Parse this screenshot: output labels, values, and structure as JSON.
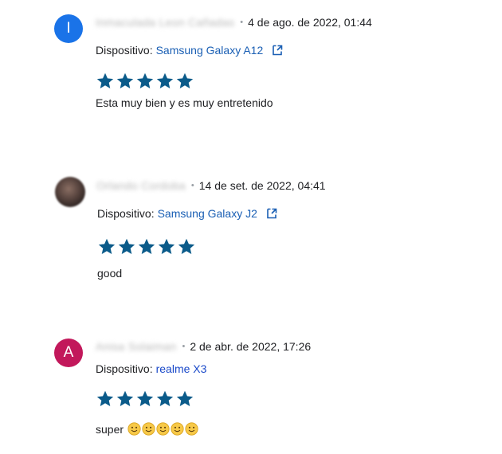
{
  "reviews": [
    {
      "avatar_letter": "I",
      "avatar_color": "#1a73e8",
      "author": "Inmaculada Leon Cañadas",
      "date": "4 de ago. de 2022, 01:44",
      "device_label": "Dispositivo:",
      "device_name": "Samsung Galaxy A12",
      "rating": 5,
      "text": "Esta muy bien y es muy entretenido"
    },
    {
      "avatar_letter": "",
      "avatar_color": "#3b2c2a",
      "author": "Orlando Cordoba",
      "date": "14 de set. de 2022, 04:41",
      "device_label": "Dispositivo:",
      "device_name": "Samsung Galaxy J2",
      "rating": 5,
      "text": "good"
    },
    {
      "avatar_letter": "A",
      "avatar_color": "#c2185b",
      "author": "Anisa Solaiman",
      "date": "2 de abr. de 2022, 17:26",
      "device_label": "Dispositivo:",
      "device_name": "realme X3",
      "rating": 5,
      "text": "super",
      "emoji": [
        "slightly-smiling-face",
        "slightly-smiling-face",
        "slightly-smiling-face",
        "slightly-smiling-face",
        "slightly-smiling-face"
      ]
    }
  ],
  "colors": {
    "star": "#0b5b8a",
    "link": "#1a5fb4",
    "date": "#202124",
    "separator": "#9aa0a6"
  },
  "icons": {
    "separator": "•",
    "device_link_icon": "open-in-new-icon",
    "rating_icon": "star-icon"
  }
}
